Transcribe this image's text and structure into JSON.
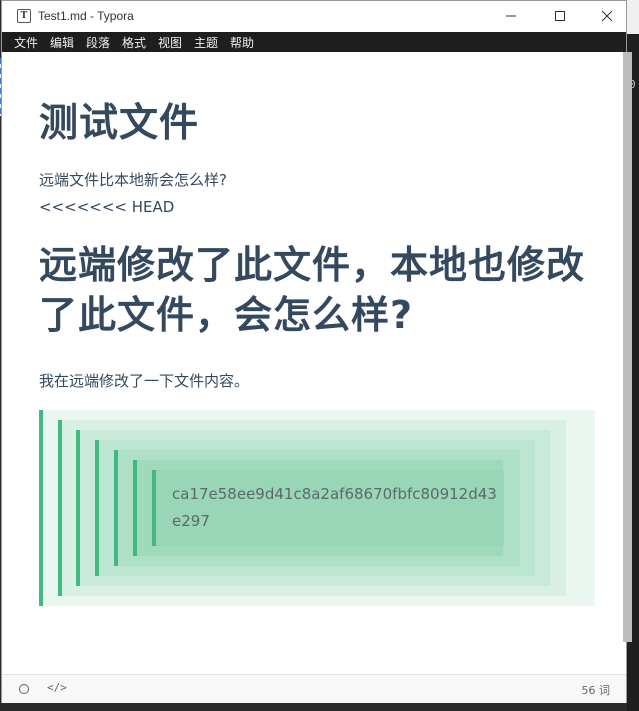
{
  "window": {
    "title": "Test1.md - Typora",
    "app_icon_glyph": "T"
  },
  "background_app": {
    "fragment": "0"
  },
  "menu": {
    "items": [
      "文件",
      "编辑",
      "段落",
      "格式",
      "视图",
      "主题",
      "帮助"
    ]
  },
  "document": {
    "heading1": "测试文件",
    "para1": "远端文件比本地新会怎么样?",
    "para2": "<<<<<<< HEAD",
    "heading2": "远端修改了此文件，本地也修改了此文件，会怎么样?",
    "para3": "我在远端修改了一下文件内容。",
    "blockquote_text": "ca17e58ee9d41c8a2af68670fbfc80912d43e297"
  },
  "statusbar": {
    "word_count": "56 词"
  },
  "colors": {
    "heading": "#34495e",
    "quote_border": "#42b983",
    "quote_bg": "#e8f6ef"
  },
  "icons": {
    "minimize": "minimize-icon",
    "maximize": "maximize-icon",
    "close": "close-icon",
    "outline": "circle-icon",
    "source_mode": "code-icon"
  }
}
